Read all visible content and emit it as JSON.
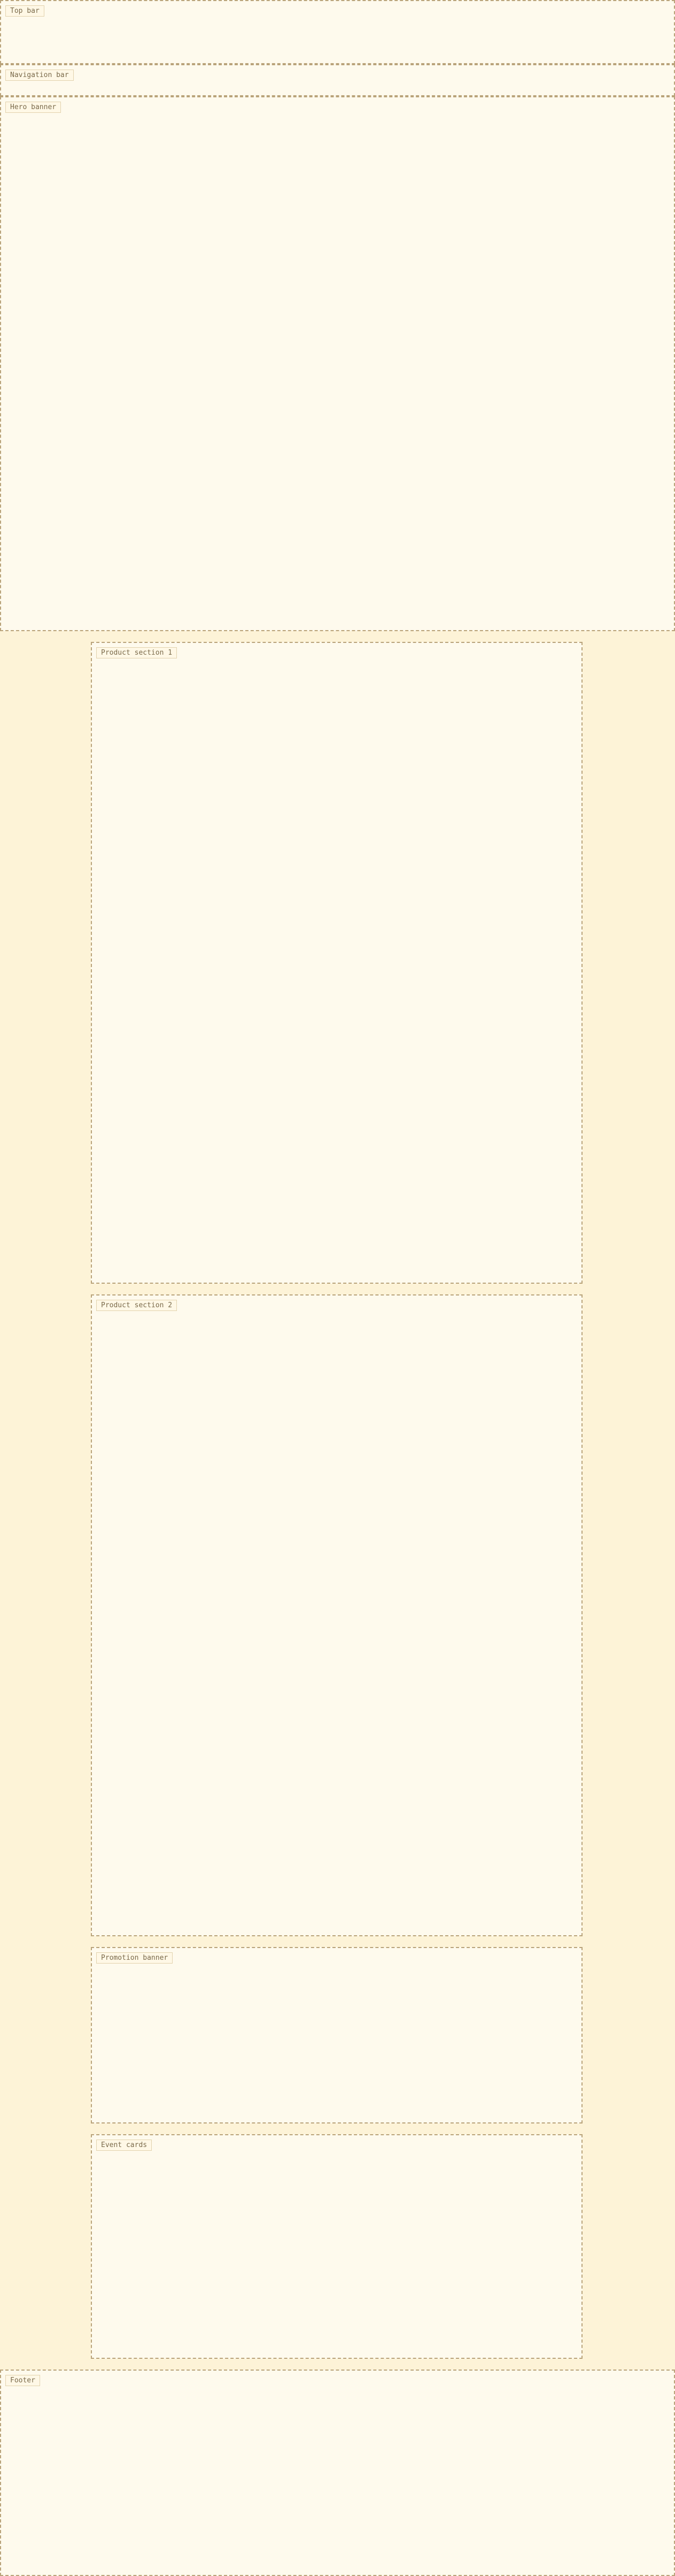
{
  "regions": [
    {
      "name": "top-bar-region",
      "label": "Top bar"
    },
    {
      "name": "nav-bar-region",
      "label": "Navigation bar"
    },
    {
      "name": "hero-banner-region",
      "label": "Hero banner"
    },
    {
      "name": "bath-section-region",
      "label": "Product section 1"
    },
    {
      "name": "daily-section-region",
      "label": "Product section 2"
    },
    {
      "name": "promo-banner-region",
      "label": "Promotion banner"
    },
    {
      "name": "event-cards-region",
      "label": "Event cards"
    },
    {
      "name": "footer-region",
      "label": "Footer"
    }
  ]
}
